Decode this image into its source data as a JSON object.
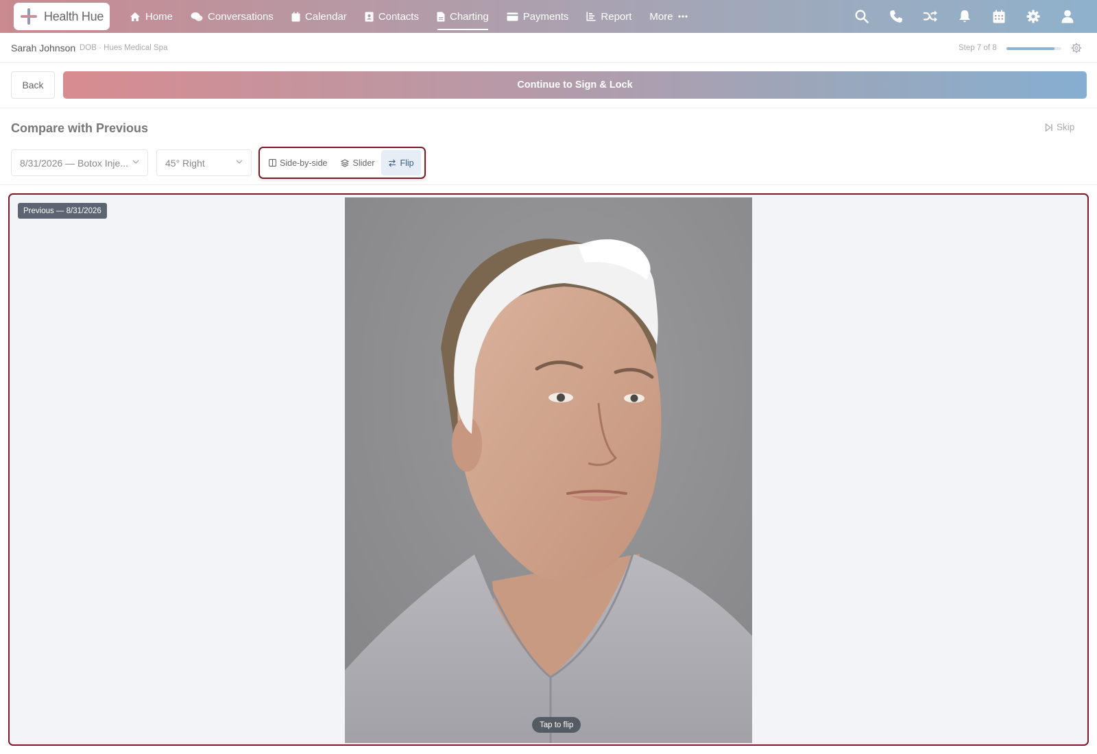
{
  "app": {
    "logo_text": "Health Hue"
  },
  "nav": {
    "items": [
      {
        "label": "Home",
        "icon": "home-icon"
      },
      {
        "label": "Conversations",
        "icon": "chat-icon"
      },
      {
        "label": "Calendar",
        "icon": "calendar-icon"
      },
      {
        "label": "Contacts",
        "icon": "contacts-icon"
      },
      {
        "label": "Charting",
        "icon": "document-icon",
        "active": true
      },
      {
        "label": "Payments",
        "icon": "credit-card-icon"
      },
      {
        "label": "Report",
        "icon": "chart-icon"
      },
      {
        "label": "More",
        "icon": "ellipsis-icon"
      }
    ],
    "right_icons": [
      "search-icon",
      "phone-icon",
      "shuffle-icon",
      "bell-icon",
      "calendar-grid-icon",
      "gear-icon",
      "user-icon"
    ]
  },
  "patient": {
    "name": "Sarah Johnson",
    "meta": "DOB · Hues Medical Spa",
    "step": "Step 7 of 8",
    "progress": 0.875
  },
  "actions": {
    "back_label": "Back",
    "continue_label": "Continue to Sign & Lock"
  },
  "section": {
    "title": "Compare with Previous",
    "skip_label": "Skip"
  },
  "controls": {
    "date_select": "8/31/2026 — Botox Inje...",
    "angle_select": "45° Right",
    "modes": [
      {
        "label": "Side-by-side",
        "icon": "columns-icon",
        "active": false
      },
      {
        "label": "Slider",
        "icon": "layers-icon",
        "active": false
      },
      {
        "label": "Flip",
        "icon": "flip-arrows-icon",
        "active": true
      }
    ]
  },
  "viewer": {
    "badge": "Previous — 8/31/2026",
    "tap_hint": "Tap to flip"
  },
  "colors": {
    "accent_border": "#7a1a26",
    "gradient_start": "#d78c90",
    "gradient_end": "#86aed0"
  }
}
